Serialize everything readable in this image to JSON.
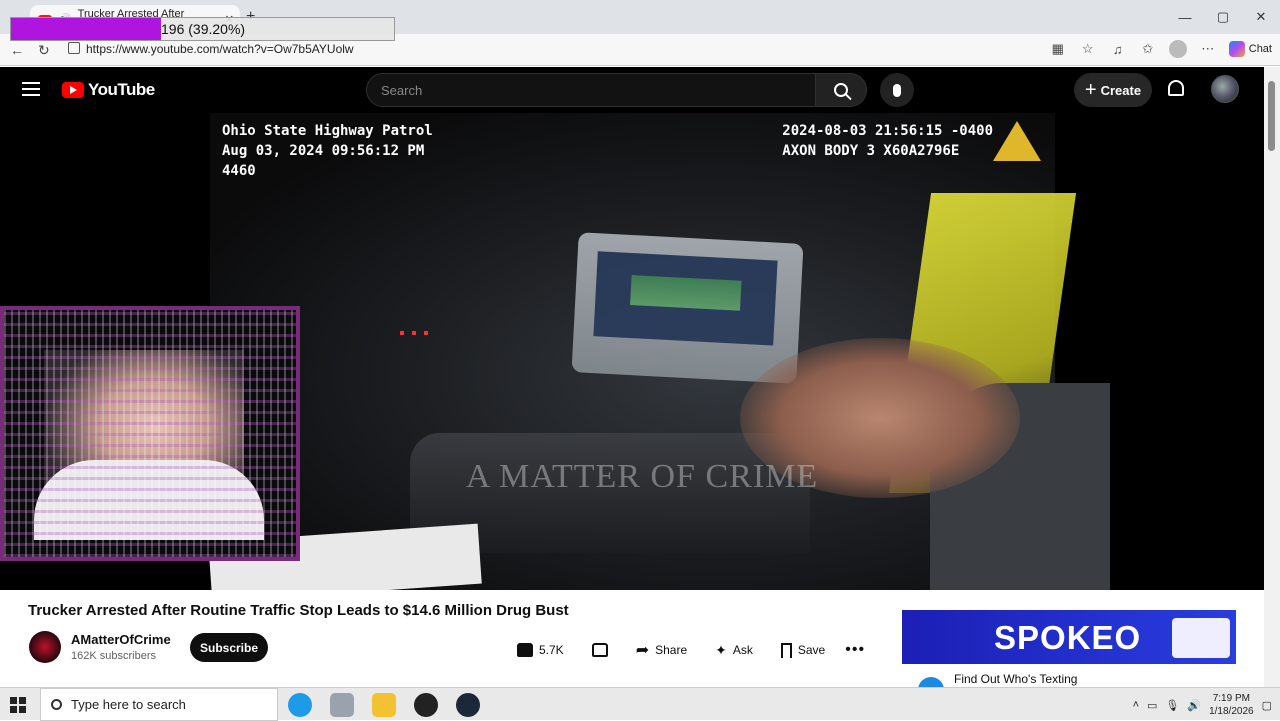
{
  "browser": {
    "tab_title": "Trucker Arrested After Routin",
    "url": "https://www.youtube.com/watch?v=Ow7b5AYUolw",
    "chat_label": "Chat"
  },
  "overlay": {
    "progress_text": "196 (39.20%)",
    "progress_fraction": 0.392,
    "fill_color": "#b015e0"
  },
  "youtube": {
    "logo_text": "YouTube",
    "search_placeholder": "Search",
    "create_label": "Create"
  },
  "video": {
    "osd_left": "Ohio State Highway Patrol\nAug 03, 2024 09:56:12 PM\n4460",
    "osd_right": "2024-08-03 21:56:15 -0400\nAXON BODY 3 X60A2796E",
    "watermark": "A MATTER OF CRIME"
  },
  "details": {
    "title": "Trucker Arrested After Routine Traffic Stop Leads to $14.6 Million Drug Bust",
    "channel_name": "AMatterOfCrime",
    "subscribers": "162K subscribers",
    "subscribe_label": "Subscribe",
    "likes": "5.7K",
    "share_label": "Share",
    "ask_label": "Ask",
    "save_label": "Save"
  },
  "ad": {
    "brand": "SPOKEO",
    "below_text": "Find Out Who's Texting"
  },
  "taskbar": {
    "search_placeholder": "Type here to search",
    "time": "7:19 PM",
    "date": "1/18/2026"
  },
  "colors": {
    "youtube_red": "#ff0000",
    "masthead_bg": "#000000",
    "ad_blue": "#1b1fb5"
  }
}
